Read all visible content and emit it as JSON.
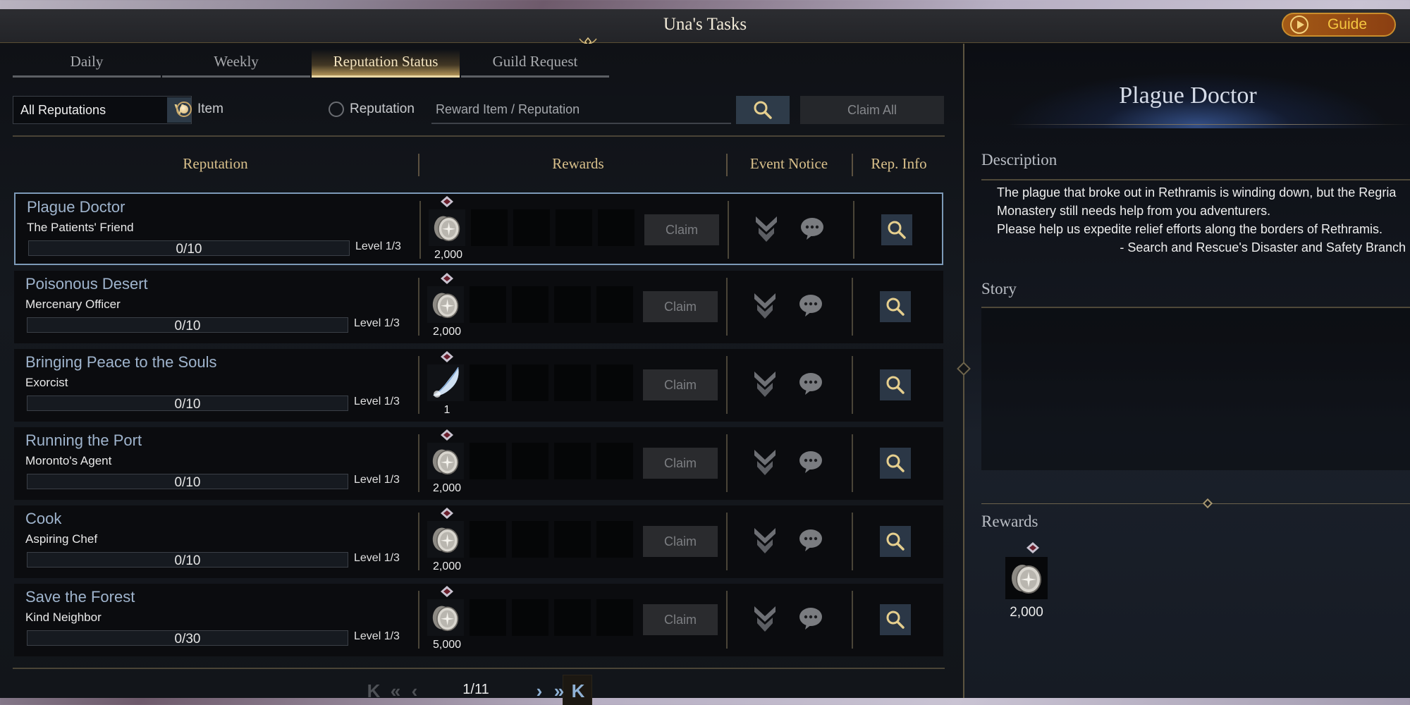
{
  "window": {
    "title": "Una's Tasks",
    "guide_label": "Guide"
  },
  "tabs": [
    {
      "label": "Daily",
      "active": false
    },
    {
      "label": "Weekly",
      "active": false
    },
    {
      "label": "Reputation Status",
      "active": true
    },
    {
      "label": "Guild Request",
      "active": false
    }
  ],
  "toolbar": {
    "filter_selected": "All Reputations",
    "radio_item_label": "Item",
    "radio_reputation_label": "Reputation",
    "radio_selected": "Item",
    "search_placeholder": "Reward Item / Reputation",
    "search_value": "",
    "claim_all_label": "Claim All"
  },
  "table": {
    "headers": {
      "reputation": "Reputation",
      "rewards": "Rewards",
      "event_notice": "Event Notice",
      "rep_info": "Rep. Info"
    },
    "rows": [
      {
        "name": "Plague Doctor",
        "title": "The Patients' Friend",
        "progress": "0/10",
        "progress_fraction": 0,
        "level": "Level 1/3",
        "reward_icon": "silver-coin-icon",
        "reward_qty": "2,000",
        "claim_label": "Claim",
        "selected": true
      },
      {
        "name": "Poisonous Desert",
        "title": "Mercenary Officer",
        "progress": "0/10",
        "progress_fraction": 0,
        "level": "Level 1/3",
        "reward_icon": "silver-coin-icon",
        "reward_qty": "2,000",
        "claim_label": "Claim",
        "selected": false
      },
      {
        "name": "Bringing Peace to the Souls",
        "title": "Exorcist",
        "progress": "0/10",
        "progress_fraction": 0,
        "level": "Level 1/3",
        "reward_icon": "feather-icon",
        "reward_qty": "1",
        "claim_label": "Claim",
        "selected": false
      },
      {
        "name": "Running the Port",
        "title": "Moronto's Agent",
        "progress": "0/10",
        "progress_fraction": 0,
        "level": "Level 1/3",
        "reward_icon": "silver-coin-icon",
        "reward_qty": "2,000",
        "claim_label": "Claim",
        "selected": false
      },
      {
        "name": "Cook",
        "title": "Aspiring Chef",
        "progress": "0/10",
        "progress_fraction": 0,
        "level": "Level 1/3",
        "reward_icon": "silver-coin-icon",
        "reward_qty": "2,000",
        "claim_label": "Claim",
        "selected": false
      },
      {
        "name": "Save the Forest",
        "title": "Kind Neighbor",
        "progress": "0/30",
        "progress_fraction": 0,
        "level": "Level 1/3",
        "reward_icon": "silver-coin-icon",
        "reward_qty": "5,000",
        "claim_label": "Claim",
        "selected": false
      }
    ]
  },
  "pagination": {
    "current_page": 1,
    "total_pages": 11,
    "label": "1/11"
  },
  "detail": {
    "title": "Plague Doctor",
    "description_label": "Description",
    "description_lines": [
      "The plague that broke out in Rethramis is winding down, but the Regria Monastery still needs help from you adventurers.",
      "Please help us expedite relief efforts along the borders of Rethramis."
    ],
    "description_signature": "- Search and Rescue's Disaster and Safety Branch",
    "story_label": "Story",
    "story_text": "",
    "rewards_label": "Rewards",
    "reward": {
      "icon": "silver-coin-icon",
      "qty": "2,000"
    }
  },
  "colors": {
    "accent_gold": "#d9c08b",
    "rep_name_blue": "#9fb4cd",
    "selected_border": "#7d9ab8",
    "guide_orange": "#a35a16"
  }
}
